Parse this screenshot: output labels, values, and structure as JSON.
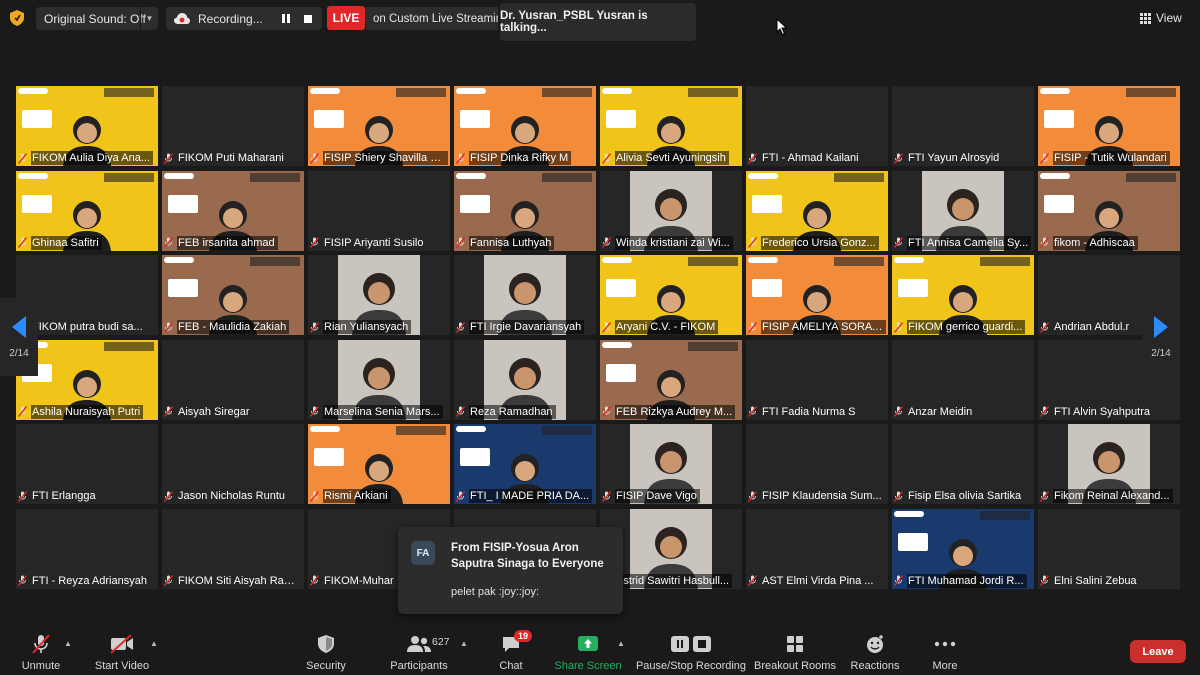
{
  "topbar": {
    "sound_label": "Original Sound: Off",
    "recording_label": "Recording...",
    "live_label": "LIVE",
    "live_text": "on Custom Live Streaming",
    "speaker_text": "Dr. Yusran_PSBL Yusran is talking...",
    "view_label": "View"
  },
  "colors": {
    "live": "#e02828",
    "arrow": "#2a8cff",
    "leave": "#c9302c",
    "share": "#27ae60",
    "muted": "#e02828"
  },
  "pager": {
    "left_label": "2/14",
    "right_label": "2/14"
  },
  "tiles": [
    {
      "name": "FIKOM Aulia Diya Ana...",
      "view": "yellow"
    },
    {
      "name": "FIKOM Puti Maharani",
      "view": "plain"
    },
    {
      "name": "FISIP Shiery Shavilla L...",
      "view": "orange"
    },
    {
      "name": "FISIP Dinka Rifky M",
      "view": "orange"
    },
    {
      "name": "Alivia Sevti Ayuningsih",
      "view": "yellow"
    },
    {
      "name": "FTI - Ahmad Kailani",
      "view": "plain"
    },
    {
      "name": "FTI Yayun Alrosyid",
      "view": "plain"
    },
    {
      "name": "FISIP - Tutik Wulandari",
      "view": "orange"
    },
    {
      "name": "Ghinaa Safitri",
      "view": "yellow"
    },
    {
      "name": "FEB irsanita ahmad",
      "view": "brown"
    },
    {
      "name": "FISIP Ariyanti Susilo",
      "view": "plain"
    },
    {
      "name": "Fannisa Luthyah",
      "view": "brown"
    },
    {
      "name": "Winda kristiani zai Wi...",
      "view": "cam"
    },
    {
      "name": "Frederico Ursia Gonz...",
      "view": "yellow"
    },
    {
      "name": "FTI Annisa Camelia Sy...",
      "view": "cam"
    },
    {
      "name": "fikom - Adhiscaa",
      "view": "brown"
    },
    {
      "name": "FIKOM putra budi sa...",
      "view": "plain"
    },
    {
      "name": "FEB - Maulidia Zakiah",
      "view": "brown"
    },
    {
      "name": "Rian Yuliansyach",
      "view": "cam"
    },
    {
      "name": "FTI Irgie Davariansyah",
      "view": "cam"
    },
    {
      "name": "Aryani C.V. - FIKOM",
      "view": "yellow"
    },
    {
      "name": "FISIP AMELIYA SORAYA",
      "view": "orange"
    },
    {
      "name": "FIKOM gerrico guardi...",
      "view": "yellow"
    },
    {
      "name": "Andrian Abdul.r",
      "view": "plain"
    },
    {
      "name": "Ashila Nuraisyah Putri",
      "view": "yellow"
    },
    {
      "name": "Aisyah Siregar",
      "view": "plain"
    },
    {
      "name": "Marselina Senia Mars...",
      "view": "cam"
    },
    {
      "name": "Reza Ramadhan",
      "view": "cam"
    },
    {
      "name": "FEB Rizkya Audrey M...",
      "view": "brown"
    },
    {
      "name": "FTI Fadia Nurma S",
      "view": "plain"
    },
    {
      "name": "Anzar Meidin",
      "view": "plain"
    },
    {
      "name": "FTI Alvin Syahputra",
      "view": "plain"
    },
    {
      "name": "FTI Erlangga",
      "view": "plain"
    },
    {
      "name": "Jason Nicholas Runtu",
      "view": "plain"
    },
    {
      "name": "Rismi Arkiani",
      "view": "orange"
    },
    {
      "name": "FTI_ I MADE PRIA DA...",
      "view": "blue"
    },
    {
      "name": "FISIP Dave Vigo",
      "view": "cam"
    },
    {
      "name": "FISIP Klaudensia Sum...",
      "view": "plain"
    },
    {
      "name": "Fisip Elsa olivia Sartika",
      "view": "plain"
    },
    {
      "name": "Fikom Reinal Alexand...",
      "view": "cam"
    },
    {
      "name": "FTI - Reyza Adriansyah",
      "view": "plain"
    },
    {
      "name": "FIKOM Siti Aisyah Ran...",
      "view": "plain"
    },
    {
      "name": "FIKOM-Muhar",
      "view": "plain"
    },
    {
      "name": "",
      "view": "plain"
    },
    {
      "name": "Astrid Sawitri Hasbull...",
      "view": "cam"
    },
    {
      "name": "AST Elmi Virda Pina ...",
      "view": "plain"
    },
    {
      "name": "FTI Muhamad Jordi R...",
      "view": "blue"
    },
    {
      "name": "Elni Salini Zebua",
      "view": "plain"
    }
  ],
  "chat_popup": {
    "avatar": "FA",
    "from": "From FISIP-Yosua Aron Saputra Sinaga to Everyone",
    "message": "pelet pak :joy::joy:"
  },
  "toolbar": {
    "unmute": "Unmute",
    "start_video": "Start Video",
    "security": "Security",
    "participants": "Participants",
    "participants_count": "627",
    "chat": "Chat",
    "chat_badge": "19",
    "share_screen": "Share Screen",
    "pause_stop": "Pause/Stop Recording",
    "breakout": "Breakout Rooms",
    "reactions": "Reactions",
    "more": "More",
    "leave": "Leave"
  }
}
